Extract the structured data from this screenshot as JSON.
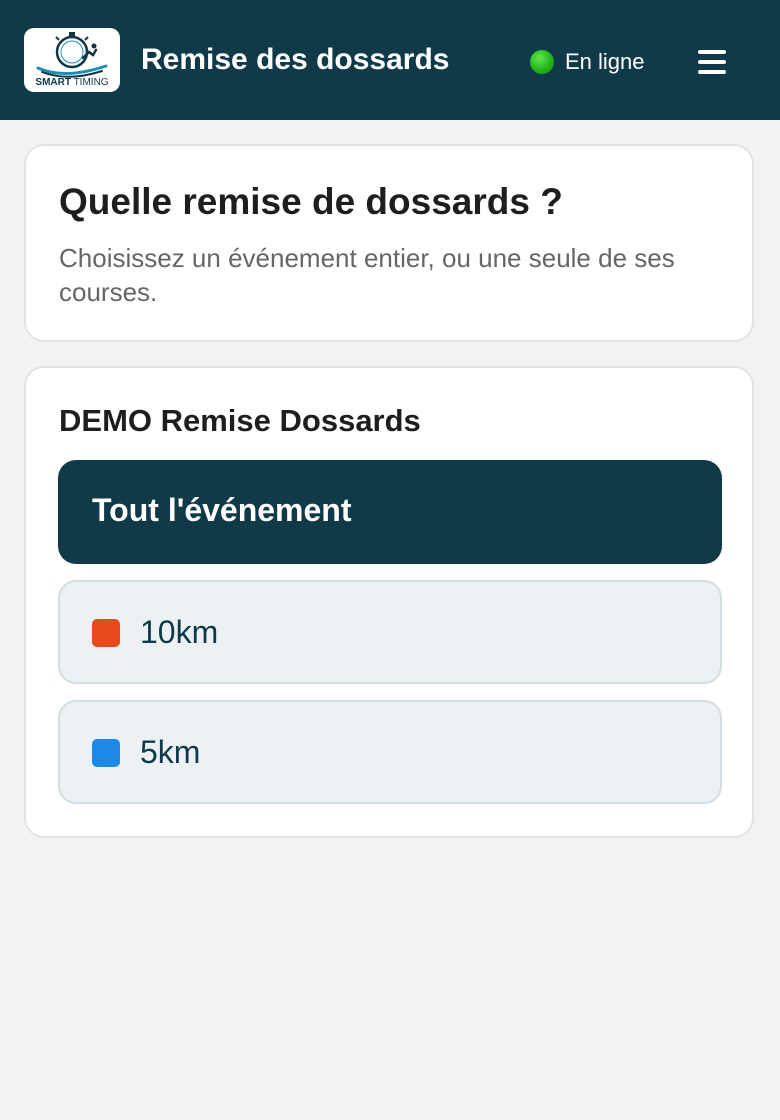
{
  "header": {
    "logo": {
      "brand_bold": "SMART",
      "brand_light": "TIMING",
      "icon": "stopwatch-runner-logo"
    },
    "title": "Remise des dossards",
    "status": {
      "label": "En ligne",
      "color": "#22b41a",
      "icon": "online-dot-icon"
    },
    "menu_icon": "hamburger-menu-icon"
  },
  "intro": {
    "title": "Quelle remise de dossards ?",
    "description": "Choisissez un événement entier, ou une seule de ses courses."
  },
  "event": {
    "name": "DEMO Remise Dossards",
    "all_button_label": "Tout l'événement",
    "races": [
      {
        "label": "10km",
        "color": "#e8491d"
      },
      {
        "label": "5km",
        "color": "#1e88e5"
      }
    ]
  },
  "theme": {
    "primary": "#113a48",
    "background": "#f3f3f2",
    "card": "#ffffff",
    "race_button_bg": "#ecf1f4"
  }
}
